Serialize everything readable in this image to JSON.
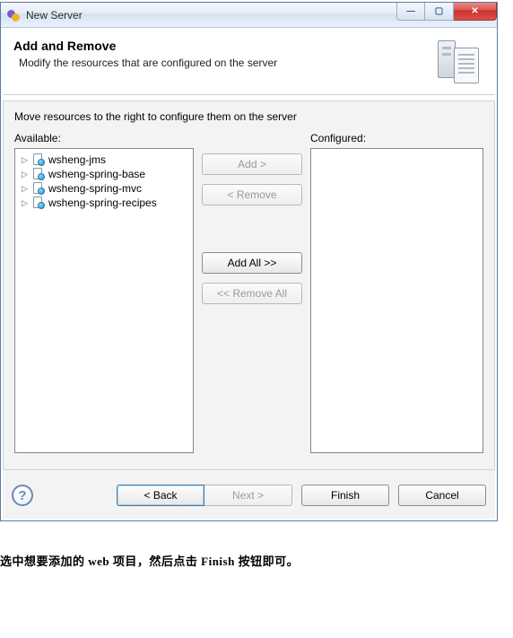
{
  "window": {
    "title": "New Server"
  },
  "header": {
    "title": "Add and Remove",
    "description": "Modify the resources that are configured on the server"
  },
  "body": {
    "instruction": "Move resources to the right to configure them on the server",
    "available_label": "Available:",
    "configured_label": "Configured:",
    "available_items": [
      {
        "label": "wsheng-jms"
      },
      {
        "label": "wsheng-spring-base"
      },
      {
        "label": "wsheng-spring-mvc"
      },
      {
        "label": "wsheng-spring-recipes"
      }
    ],
    "buttons": {
      "add": "Add >",
      "remove": "< Remove",
      "add_all": "Add All >>",
      "remove_all": "<< Remove All"
    }
  },
  "footer": {
    "back": "< Back",
    "next": "Next >",
    "finish": "Finish",
    "cancel": "Cancel"
  },
  "caption": "选中想要添加的 web 项目，然后点击 Finish 按钮即可。"
}
